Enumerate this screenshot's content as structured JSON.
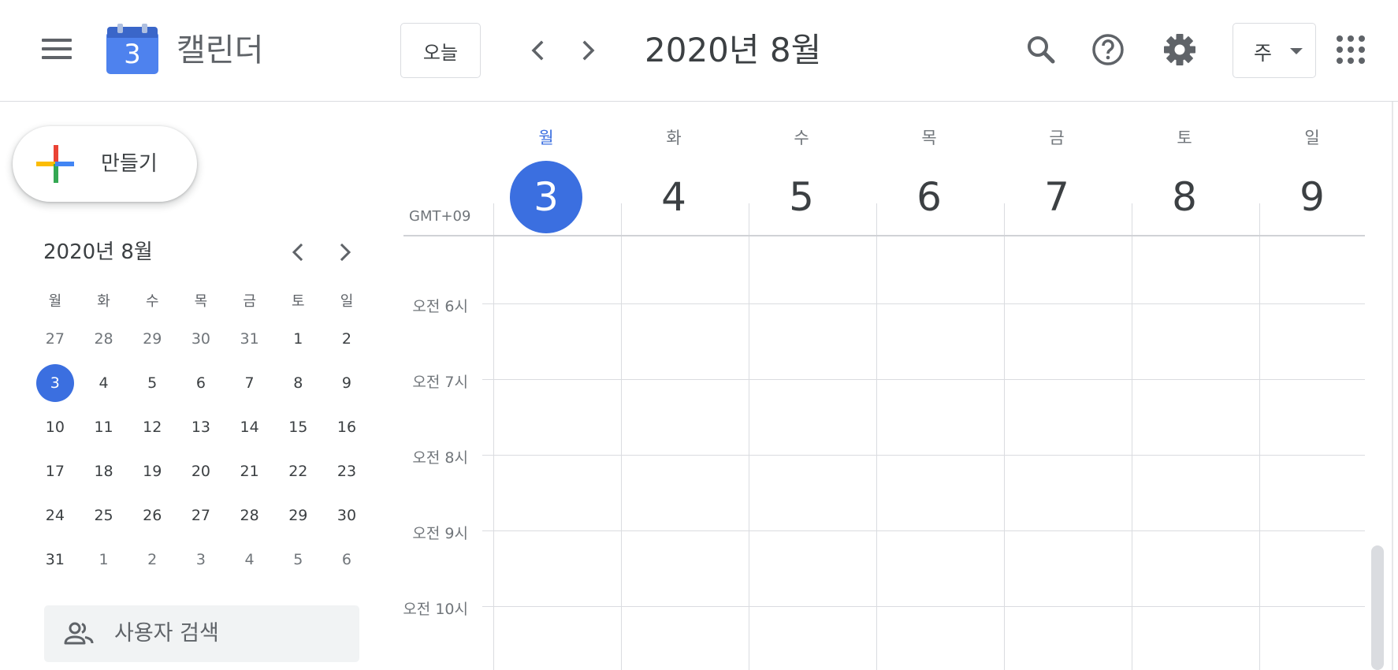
{
  "header": {
    "logo_day": "3",
    "app_title": "캘린더",
    "today_label": "오늘",
    "current_range": "2020년 8월",
    "view_label": "주",
    "icons": [
      "menu-icon",
      "chevron-left-icon",
      "chevron-right-icon",
      "search-icon",
      "help-icon",
      "gear-icon",
      "apps-grid-icon"
    ]
  },
  "sidebar": {
    "create_label": "만들기",
    "mini_calendar": {
      "title": "2020년 8월",
      "weekdays": [
        "월",
        "화",
        "수",
        "목",
        "금",
        "토",
        "일"
      ],
      "weeks": [
        [
          "27",
          "28",
          "29",
          "30",
          "31",
          "1",
          "2"
        ],
        [
          "3",
          "4",
          "5",
          "6",
          "7",
          "8",
          "9"
        ],
        [
          "10",
          "11",
          "12",
          "13",
          "14",
          "15",
          "16"
        ],
        [
          "17",
          "18",
          "19",
          "20",
          "21",
          "22",
          "23"
        ],
        [
          "24",
          "25",
          "26",
          "27",
          "28",
          "29",
          "30"
        ],
        [
          "31",
          "1",
          "2",
          "3",
          "4",
          "5",
          "6"
        ]
      ],
      "today": "3"
    },
    "search_people_placeholder": "사용자 검색"
  },
  "week": {
    "timezone": "GMT+09",
    "days": [
      {
        "name": "월",
        "date": "3",
        "today": true
      },
      {
        "name": "화",
        "date": "4"
      },
      {
        "name": "수",
        "date": "5"
      },
      {
        "name": "목",
        "date": "6"
      },
      {
        "name": "금",
        "date": "7"
      },
      {
        "name": "토",
        "date": "8"
      },
      {
        "name": "일",
        "date": "9"
      }
    ],
    "hours": [
      "오전 6시",
      "오전 7시",
      "오전 8시",
      "오전 9시",
      "오전 10시"
    ]
  },
  "colors": {
    "accent": "#3b6fe0",
    "gridline": "#dadce0",
    "text": "#3c4043",
    "muted": "#70757a"
  }
}
